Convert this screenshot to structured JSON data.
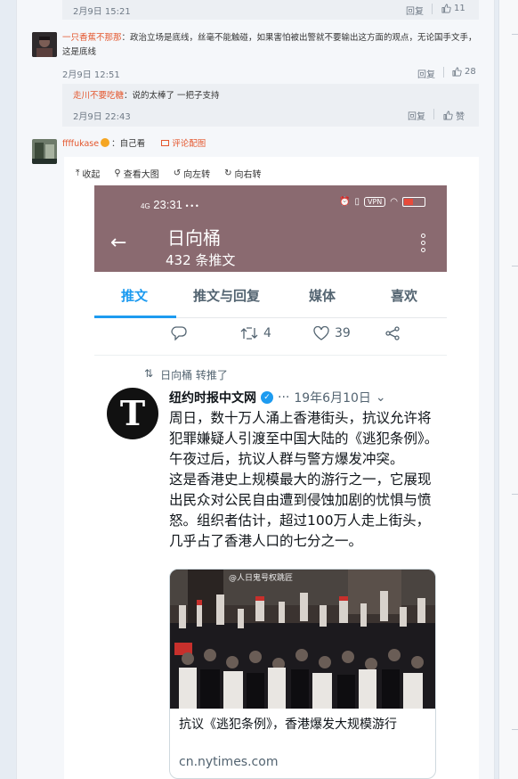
{
  "top_reply": {
    "time": "2月9日 15:21",
    "reply_label": "回复",
    "likes": "11"
  },
  "comment1": {
    "user": "一只香蕉不那那",
    "colon": "：",
    "text": "政治立场是底线，丝毫不能触碰，如果害怕被出警就不要输出这方面的观点，无论国手文手，这是底线",
    "time": "2月9日 12:51",
    "reply_label": "回复",
    "likes": "28"
  },
  "reply1": {
    "user": "走川不要吃糖",
    "colon": "：",
    "text": "说的太棒了 一把子支持",
    "time": "2月9日 22:43",
    "reply_label": "回复",
    "like_label": "赞"
  },
  "comment2": {
    "user": "ffffukase",
    "colon": "：",
    "text": "自己看",
    "image_link": "评论配图"
  },
  "image_toolbar": {
    "collapse": "收起",
    "view_large": "查看大图",
    "rotate_left": "向左转",
    "rotate_right": "向右转"
  },
  "phone": {
    "status_time": "23:31",
    "status_signal": "4G",
    "status_dots": "• • •",
    "status_vpn": "VPN",
    "profile_name": "日向桶",
    "tweet_count": "432 条推文",
    "tabs": [
      "推文",
      "推文与回复",
      "媒体",
      "喜欢"
    ],
    "actions": {
      "retweets": "4",
      "likes": "39"
    },
    "retweeted_by": "日向桶 转推了",
    "tweet": {
      "author": "纽约时报中文网",
      "dots": "···",
      "date": "19年6月10日",
      "logo_letter": "T",
      "p1": "周日，数十万人涌上香港街头，抗议允许将犯罪嫌疑人引渡至中国大陆的《逃犯条例》。午夜过后，抗议人群与警方爆发冲突。",
      "p2": "这是香港史上规模最大的游行之一，它展现出民众对公民自由遭到侵蚀加剧的忧惧与愤怒。组织者估计，超过100万人走上街头，几乎占了香港人口的七分之一。",
      "card_title": "抗议《逃犯条例》，香港爆发大规模游行",
      "card_domain": "cn.nytimes.com",
      "watermark": "@人日鬼号权跳匠"
    }
  },
  "colors": {
    "username": "#e4572e",
    "twitter_blue": "#1d9bf0",
    "header_bg": "#8a6a70"
  }
}
